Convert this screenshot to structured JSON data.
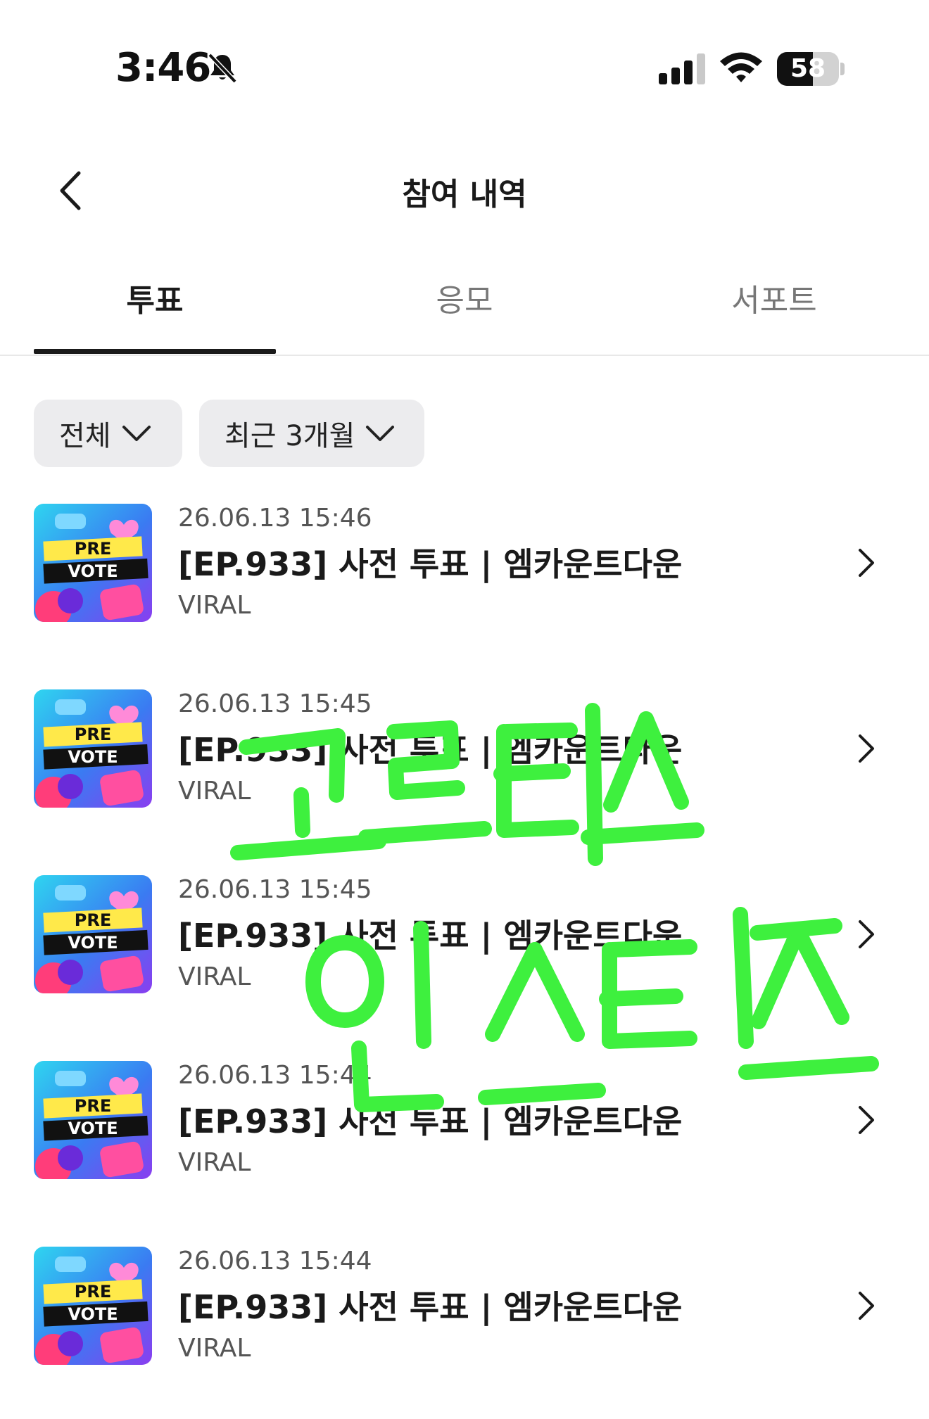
{
  "status_bar": {
    "time": "3:46",
    "battery": "58",
    "battery_level": 0.58,
    "icons": [
      "bell-slash-icon",
      "cellular-signal-icon",
      "wifi-icon",
      "battery-icon"
    ]
  },
  "header": {
    "title": "참여 내역",
    "back_icon": "chevron-left-icon"
  },
  "tabs": [
    {
      "label": "투표",
      "active": true
    },
    {
      "label": "응모",
      "active": false
    },
    {
      "label": "서포트",
      "active": false
    }
  ],
  "filters": {
    "type_label": "전체",
    "period_label": "최근 3개월"
  },
  "items": [
    {
      "date": "26.06.13 15:46",
      "title": "[EP.933] 사전 투표 | 엠카운트다운",
      "category": "VIRAL",
      "thumbnail_text": [
        "PRE",
        "VOTE"
      ]
    },
    {
      "date": "26.06.13 15:45",
      "title": "[EP.933] 사전 투표 | 엠카운트다운",
      "category": "VIRAL",
      "thumbnail_text": [
        "PRE",
        "VOTE"
      ]
    },
    {
      "date": "26.06.13 15:45",
      "title": "[EP.933] 사전 투표 | 엠카운트다운",
      "category": "VIRAL",
      "thumbnail_text": [
        "PRE",
        "VOTE"
      ]
    },
    {
      "date": "26.06.13 15:44",
      "title": "[EP.933] 사전 투표 | 엠카운트다운",
      "category": "VIRAL",
      "thumbnail_text": [
        "PRE",
        "VOTE"
      ]
    },
    {
      "date": "26.06.13 15:44",
      "title": "[EP.933] 사전 투표 | 엠카운트다운",
      "category": "VIRAL",
      "thumbnail_text": [
        "PRE",
        "VOTE"
      ]
    }
  ],
  "overlay": {
    "handwritten_lines": [
      "코르티스",
      "인스티즈"
    ],
    "color": "#3ef03e"
  },
  "colors": {
    "text_primary": "#1a1a1a",
    "text_secondary": "#555555",
    "filter_bg": "#ececee",
    "tab_indicator": "#1a1a1a"
  }
}
